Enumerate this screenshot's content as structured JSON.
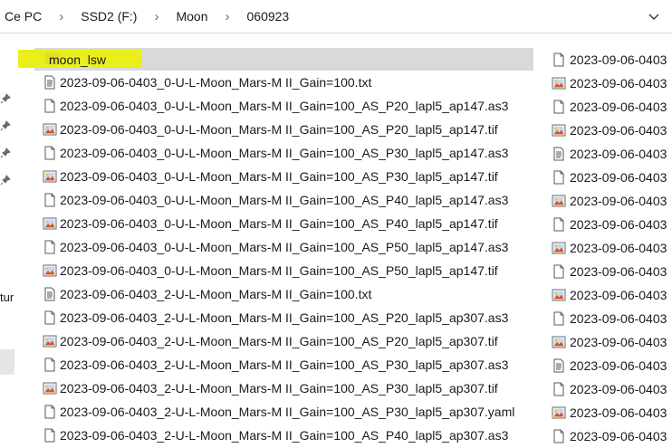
{
  "breadcrumb": [
    "Ce PC",
    "SSD2 (F:)",
    "Moon",
    "060923"
  ],
  "left_pane": {
    "partial_label": "tur"
  },
  "colors": {
    "highlight": "#e9ef1a",
    "selected_row": "#d9d9d9"
  },
  "files": [
    {
      "name": "moon_lsw",
      "icon": "folder-icon"
    },
    {
      "name": "2023-09-06-0403_0-U-L-Moon_Mars-M II_Gain=100.txt",
      "icon": "text-file-icon"
    },
    {
      "name": "2023-09-06-0403_0-U-L-Moon_Mars-M II_Gain=100_AS_P20_lapl5_ap147.as3",
      "icon": "blank-file-icon"
    },
    {
      "name": "2023-09-06-0403_0-U-L-Moon_Mars-M II_Gain=100_AS_P20_lapl5_ap147.tif",
      "icon": "image-file-icon"
    },
    {
      "name": "2023-09-06-0403_0-U-L-Moon_Mars-M II_Gain=100_AS_P30_lapl5_ap147.as3",
      "icon": "blank-file-icon"
    },
    {
      "name": "2023-09-06-0403_0-U-L-Moon_Mars-M II_Gain=100_AS_P30_lapl5_ap147.tif",
      "icon": "image-file-icon"
    },
    {
      "name": "2023-09-06-0403_0-U-L-Moon_Mars-M II_Gain=100_AS_P40_lapl5_ap147.as3",
      "icon": "blank-file-icon"
    },
    {
      "name": "2023-09-06-0403_0-U-L-Moon_Mars-M II_Gain=100_AS_P40_lapl5_ap147.tif",
      "icon": "image-file-icon"
    },
    {
      "name": "2023-09-06-0403_0-U-L-Moon_Mars-M II_Gain=100_AS_P50_lapl5_ap147.as3",
      "icon": "blank-file-icon"
    },
    {
      "name": "2023-09-06-0403_0-U-L-Moon_Mars-M II_Gain=100_AS_P50_lapl5_ap147.tif",
      "icon": "image-file-icon"
    },
    {
      "name": "2023-09-06-0403_2-U-L-Moon_Mars-M II_Gain=100.txt",
      "icon": "text-file-icon"
    },
    {
      "name": "2023-09-06-0403_2-U-L-Moon_Mars-M II_Gain=100_AS_P20_lapl5_ap307.as3",
      "icon": "blank-file-icon"
    },
    {
      "name": "2023-09-06-0403_2-U-L-Moon_Mars-M II_Gain=100_AS_P20_lapl5_ap307.tif",
      "icon": "image-file-icon"
    },
    {
      "name": "2023-09-06-0403_2-U-L-Moon_Mars-M II_Gain=100_AS_P30_lapl5_ap307.as3",
      "icon": "blank-file-icon"
    },
    {
      "name": "2023-09-06-0403_2-U-L-Moon_Mars-M II_Gain=100_AS_P30_lapl5_ap307.tif",
      "icon": "image-file-icon"
    },
    {
      "name": "2023-09-06-0403_2-U-L-Moon_Mars-M II_Gain=100_AS_P30_lapl5_ap307.yaml",
      "icon": "blank-file-icon"
    },
    {
      "name": "2023-09-06-0403_2-U-L-Moon_Mars-M II_Gain=100_AS_P40_lapl5_ap307.as3",
      "icon": "blank-file-icon"
    }
  ],
  "files_col2": [
    {
      "name": "2023-09-06-0403",
      "icon": "blank-file-icon"
    },
    {
      "name": "2023-09-06-0403",
      "icon": "image-file-icon"
    },
    {
      "name": "2023-09-06-0403",
      "icon": "blank-file-icon"
    },
    {
      "name": "2023-09-06-0403",
      "icon": "image-file-icon"
    },
    {
      "name": "2023-09-06-0403",
      "icon": "text-file-icon"
    },
    {
      "name": "2023-09-06-0403",
      "icon": "blank-file-icon"
    },
    {
      "name": "2023-09-06-0403",
      "icon": "image-file-icon"
    },
    {
      "name": "2023-09-06-0403",
      "icon": "blank-file-icon"
    },
    {
      "name": "2023-09-06-0403",
      "icon": "image-file-icon"
    },
    {
      "name": "2023-09-06-0403",
      "icon": "blank-file-icon"
    },
    {
      "name": "2023-09-06-0403",
      "icon": "image-file-icon"
    },
    {
      "name": "2023-09-06-0403",
      "icon": "blank-file-icon"
    },
    {
      "name": "2023-09-06-0403",
      "icon": "image-file-icon"
    },
    {
      "name": "2023-09-06-0403",
      "icon": "text-file-icon"
    },
    {
      "name": "2023-09-06-0403",
      "icon": "blank-file-icon"
    },
    {
      "name": "2023-09-06-0403",
      "icon": "image-file-icon"
    },
    {
      "name": "2023-09-06-0403",
      "icon": "blank-file-icon"
    }
  ]
}
